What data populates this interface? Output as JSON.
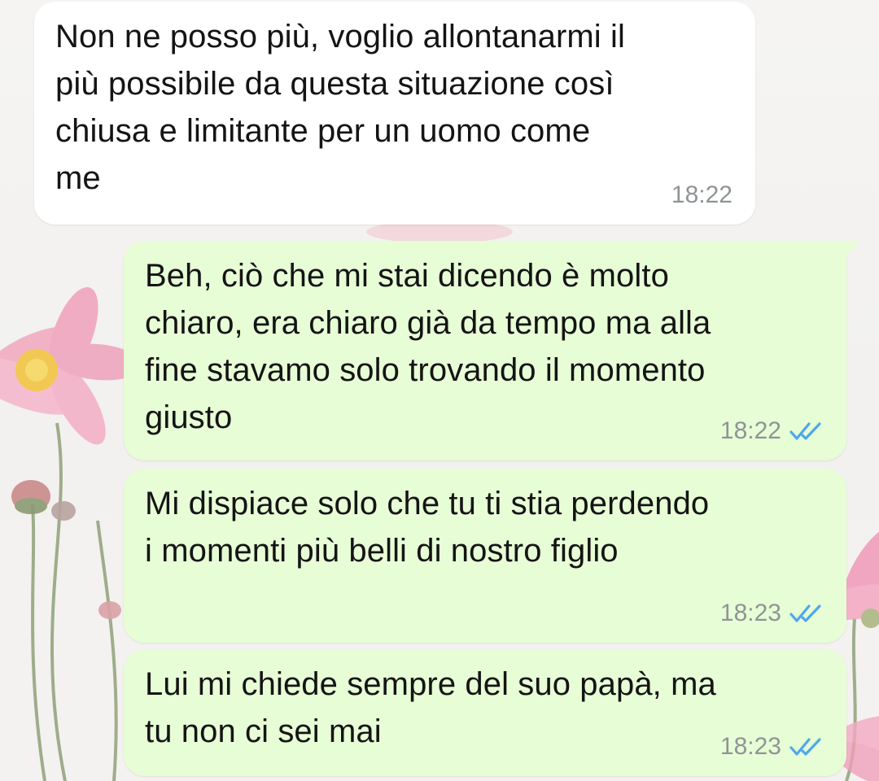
{
  "messages": [
    {
      "direction": "incoming",
      "text": "Non ne posso più, voglio allontanarmi il\npiù possibile da questa situazione così\nchiusa e limitante per un uomo come\nme",
      "time": "18:22"
    },
    {
      "direction": "outgoing",
      "text": "Beh, ciò che mi stai dicendo è molto\nchiaro, era chiaro già da tempo ma alla\nfine stavamo solo trovando il momento\ngiusto",
      "time": "18:22",
      "status_icon": "double-check-read-icon"
    },
    {
      "direction": "outgoing",
      "text": "Mi dispiace solo che tu ti stia perdendo\ni momenti più belli di nostro figlio",
      "time": "18:23",
      "status_icon": "double-check-read-icon"
    },
    {
      "direction": "outgoing",
      "text": "Lui mi chiede sempre del suo papà, ma\ntu non ci sei mai",
      "time": "18:23",
      "status_icon": "double-check-read-icon"
    }
  ],
  "colors": {
    "incoming_bubble": "#ffffff",
    "outgoing_bubble": "#e7fdd6",
    "read_tick": "#4fa8e8",
    "timestamp": "#8f9496"
  },
  "wallpaper_icon": "pink-cosmos-flowers-wallpaper"
}
